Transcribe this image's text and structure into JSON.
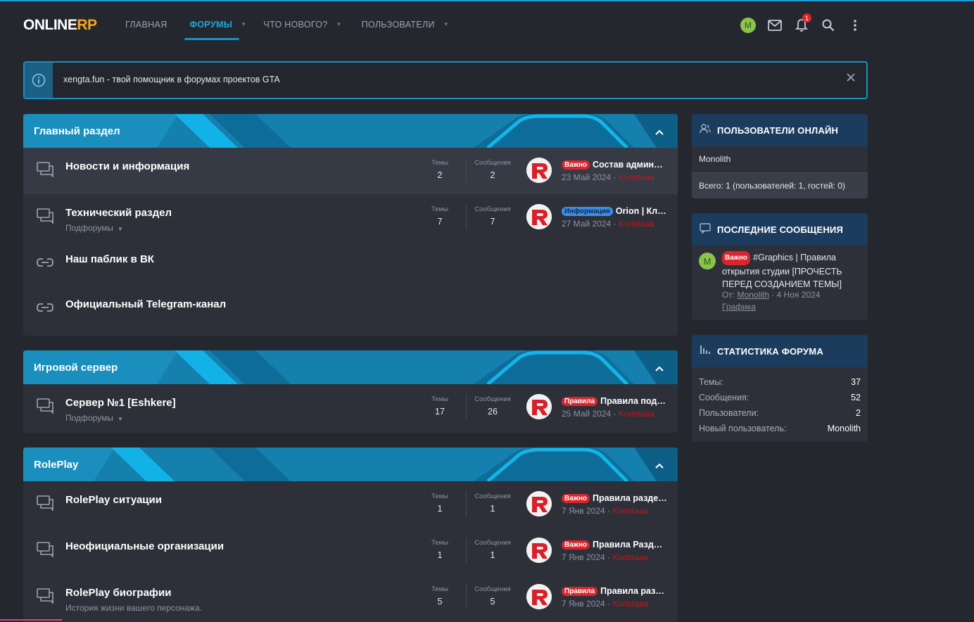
{
  "header": {
    "logo_main": "ONLINE",
    "logo_accent": "RP",
    "nav": [
      {
        "label": "ГЛАВНАЯ"
      },
      {
        "label": "ФОРУМЫ"
      },
      {
        "label": "ЧТО НОВОГО?"
      },
      {
        "label": "ПОЛЬЗОВАТЕЛИ"
      }
    ],
    "avatar_letter": "M",
    "notification_count": "1"
  },
  "notice": {
    "text": "xengta.fun - твой помощник в форумах проектов GTA"
  },
  "categories": [
    {
      "title": "Главный раздел",
      "nodes": [
        {
          "title": "Новости и информация",
          "sub": "",
          "themes_label": "Темы",
          "themes": "2",
          "msgs_label": "Сообщения",
          "msgs": "2",
          "tag": "Важно",
          "last_title": "Состав администрации",
          "last_date": "23 Май 2024",
          "last_user": "Koristaaa"
        },
        {
          "title": "Технический раздел",
          "sub": "Подфорумы",
          "themes_label": "Темы",
          "themes": "7",
          "msgs_label": "Сообщения",
          "msgs": "7",
          "tag": "Информация",
          "last_title": "Orion | Клан",
          "last_date": "27 Май 2024",
          "last_user": "Koristaaa"
        },
        {
          "title": "Наш паблик в ВК"
        },
        {
          "title": "Официальный Telegram-канал"
        }
      ]
    },
    {
      "title": "Игровой сервер",
      "nodes": [
        {
          "title": "Сервер №1 [Eshkere]",
          "sub": "Подфорумы",
          "themes_label": "Темы",
          "themes": "17",
          "msgs_label": "Сообщения",
          "msgs": "26",
          "tag": "Правила",
          "last_title": "Правила подачи жалоб",
          "last_date": "25 Май 2024",
          "last_user": "Koristaaa"
        }
      ]
    },
    {
      "title": "RolePlay",
      "nodes": [
        {
          "title": "RolePlay ситуации",
          "sub": "",
          "themes_label": "Темы",
          "themes": "1",
          "msgs_label": "Сообщения",
          "msgs": "1",
          "tag": "Важно",
          "last_title": "Правила раздела",
          "last_date": "7 Янв 2024",
          "last_user": "Koristaaa"
        },
        {
          "title": "Неофициальные организации",
          "sub": "",
          "themes_label": "Темы",
          "themes": "1",
          "msgs_label": "Сообщения",
          "msgs": "1",
          "tag": "Важно",
          "last_title": "Правила Раздела",
          "last_date": "7 Янв 2024",
          "last_user": "Koristaaa"
        },
        {
          "title": "RolePlay биографии",
          "sub": "История жизни вашего персонажа.",
          "themes_label": "Темы",
          "themes": "5",
          "msgs_label": "Сообщения",
          "msgs": "5",
          "tag": "Правила",
          "last_title": "Правила раздела",
          "last_date": "7 Янв 2024",
          "last_user": "Koristaaa"
        }
      ]
    }
  ],
  "sidebar": {
    "online": {
      "title": "ПОЛЬЗОВАТЕЛИ ОНЛАЙН",
      "user": "Monolith",
      "total": "Всего: 1 (пользователей: 1, гостей: 0)"
    },
    "latest": {
      "title": "ПОСЛЕДНИЕ СООБЩЕНИЯ",
      "avatar_letter": "M",
      "tag": "Важно",
      "text": "#Graphics | Правила открытия студии [ПРОЧЕСТЬ ПЕРЕД СОЗДАНИЕМ ТЕМЫ]",
      "from_label": "От:",
      "author": "Monolith",
      "date": "4 Ноя 2024",
      "forum": "Графика"
    },
    "stats": {
      "title": "СТАТИСТИКА ФОРУМА",
      "rows": [
        {
          "k": "Темы:",
          "v": "37"
        },
        {
          "k": "Сообщения:",
          "v": "52"
        },
        {
          "k": "Пользователи:",
          "v": "2"
        },
        {
          "k": "Новый пользователь:",
          "v": "Monolith"
        }
      ]
    }
  },
  "colors": {
    "accent": "#1a8fc4",
    "brand_orange": "#f5a623",
    "tag_red": "#d7262d",
    "tag_blue": "#3a8ee8",
    "user_red": "#c01818"
  }
}
